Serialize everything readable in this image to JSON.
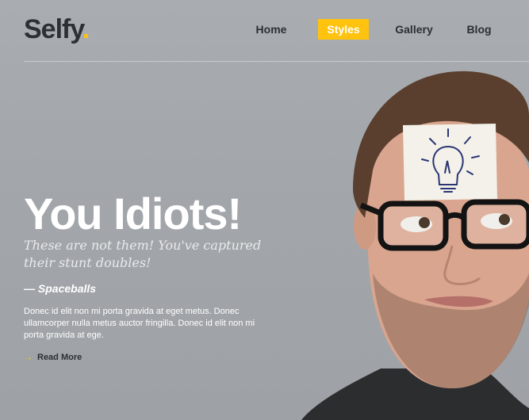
{
  "brand": {
    "name": "Selfy",
    "dot": ".",
    "accent": "#ffc20e"
  },
  "nav": {
    "items": [
      {
        "label": "Home",
        "active": false
      },
      {
        "label": "Styles",
        "active": true
      },
      {
        "label": "Gallery",
        "active": false
      },
      {
        "label": "Blog",
        "active": false
      }
    ]
  },
  "hero": {
    "title": "You Idiots!",
    "subtitle": "These are not them! You've captured their stunt doubles!",
    "quote": "— Spaceballs",
    "body": "Donec id elit non mi porta gravida at eget metus. Donec ullamcorper nulla metus auctor fringilla. Donec id elit non mi porta gravida at ege.",
    "read_more": "Read More"
  },
  "icons": {
    "read_more": "arrow-icon",
    "note": "lightbulb-icon"
  }
}
